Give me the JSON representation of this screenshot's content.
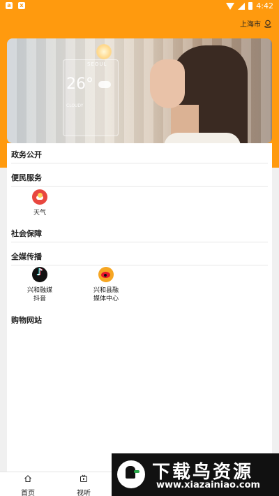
{
  "status_bar": {
    "time": "4:42"
  },
  "header": {
    "city": "上海市",
    "bg_color": "#FF9A0E"
  },
  "banner": {
    "city": "SEOUL",
    "temperature": "26°",
    "condition": "CLOUDY"
  },
  "sections": {
    "gov_open": {
      "title": "政务公开"
    },
    "convenience": {
      "title": "便民服务",
      "items": [
        {
          "label": "天气",
          "icon": "weather-icon"
        }
      ]
    },
    "social_security": {
      "title": "社会保障"
    },
    "media": {
      "title": "全媒传播",
      "items": [
        {
          "label_line1": "兴和融媒",
          "label_line2": "抖音",
          "icon": "douyin-icon"
        },
        {
          "label_line1": "兴和县融",
          "label_line2": "媒体中心",
          "icon": "weibo-icon"
        }
      ]
    },
    "shopping": {
      "title": "购物网站"
    }
  },
  "tabbar": {
    "items": [
      {
        "label": "首页",
        "icon": "home-icon"
      },
      {
        "label": "视听",
        "icon": "video-icon"
      }
    ]
  },
  "watermark": {
    "title": "下载鸟资源",
    "url": "www.xiazainiao.com"
  }
}
